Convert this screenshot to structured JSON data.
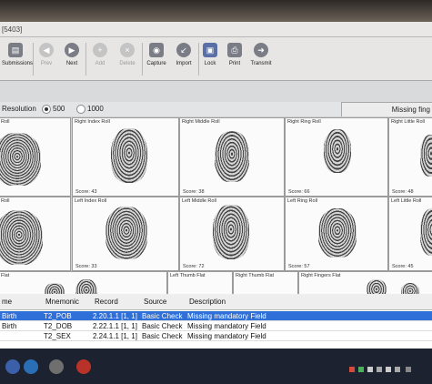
{
  "window": {
    "title": "[5403]"
  },
  "toolbar": [
    {
      "label": "Submissions",
      "icon": "submissions-icon",
      "enabled": true
    },
    {
      "label": "Prev",
      "icon": "prev-arrow-icon",
      "enabled": false
    },
    {
      "label": "Next",
      "icon": "next-arrow-icon",
      "enabled": true
    },
    {
      "label": "Add",
      "icon": "add-icon",
      "enabled": false
    },
    {
      "label": "Delete",
      "icon": "delete-icon",
      "enabled": false
    },
    {
      "label": "Capture",
      "icon": "capture-icon",
      "enabled": true
    },
    {
      "label": "Import",
      "icon": "import-icon",
      "enabled": true
    },
    {
      "label": "Lock",
      "icon": "lock-icon",
      "enabled": true
    },
    {
      "label": "Print",
      "icon": "printer-icon",
      "enabled": true
    },
    {
      "label": "Transmit",
      "icon": "transmit-icon",
      "enabled": true
    }
  ],
  "resolution": {
    "label": "Resolution",
    "options": [
      "500",
      "1000"
    ],
    "selected": "500"
  },
  "missing_button": "Missing fing",
  "prints": [
    {
      "name": "Roll",
      "score": ""
    },
    {
      "name": "Right Index Roll",
      "score": "Score: 43"
    },
    {
      "name": "Right Middle Roll",
      "score": "Score: 38"
    },
    {
      "name": "Right Ring Roll",
      "score": "Score: 66"
    },
    {
      "name": "Right Little Roll",
      "score": "Score: 48"
    },
    {
      "name": "Roll",
      "score": ""
    },
    {
      "name": "Left Index Roll",
      "score": "Score: 33"
    },
    {
      "name": "Left Middle Roll",
      "score": "Score: 72"
    },
    {
      "name": "Left Ring Roll",
      "score": "Score: 57"
    },
    {
      "name": "Left Little Roll",
      "score": "Score: 45"
    },
    {
      "name": "Flat",
      "score": ""
    },
    {
      "name": "Left Thumb Flat",
      "score": ""
    },
    {
      "name": "Right Thumb Flat",
      "score": ""
    },
    {
      "name": "Right Fingers Flat",
      "score": ""
    }
  ],
  "table": {
    "headers": [
      "me",
      "Mnemonic",
      "Record",
      "Source",
      "Description"
    ],
    "rows": [
      [
        "Birth",
        "T2_POB",
        "2.20.1.1 [1, 1]",
        "Basic Check",
        "Missing mandatory Field"
      ],
      [
        "Birth",
        "T2_DOB",
        "2.22.1.1 [1, 1]",
        "Basic Check",
        "Missing mandatory Field"
      ],
      [
        "",
        "T2_SEX",
        "2.24.1.1 [1, 1]",
        "Basic Check",
        "Missing mandatory Field"
      ]
    ]
  },
  "colors": {
    "selected_row": "#2f6fd8",
    "taskbar": "#1d2230",
    "toolbar": "#e7e6e4"
  }
}
